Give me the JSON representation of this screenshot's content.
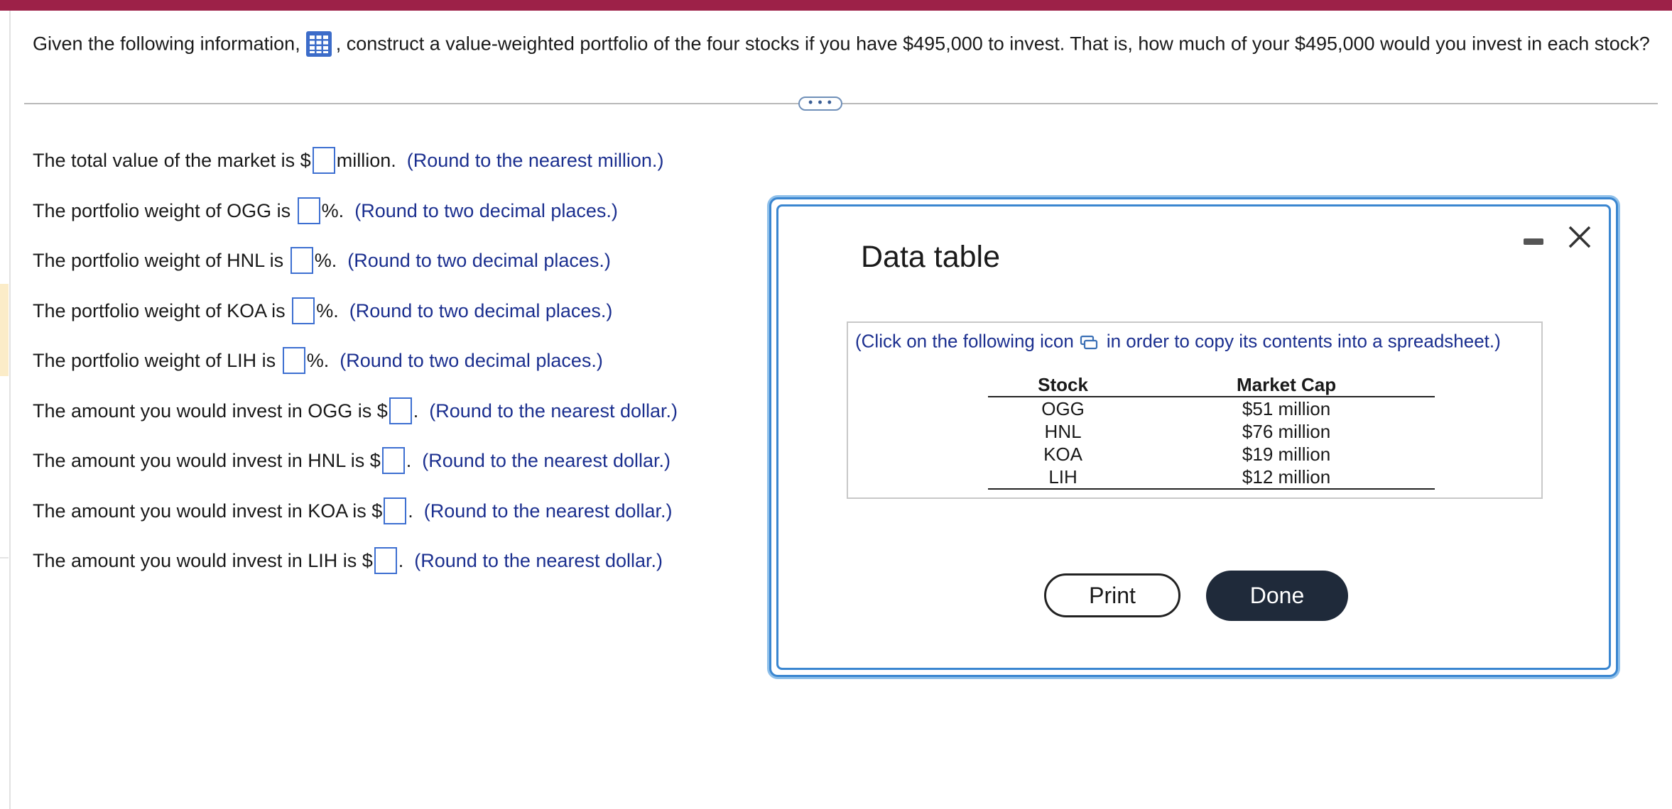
{
  "question": {
    "prefix": "Given the following information,",
    "icon": "data-table-grid-icon",
    "suffix": ", construct a value-weighted portfolio of the four stocks if you have $495,000 to invest. That is, how much of your $495,000 would you invest in each stock?"
  },
  "more_button": "• • •",
  "rows": [
    {
      "label": "The total value of the market is $",
      "after": "million.",
      "hint": "(Round to the nearest million.)"
    },
    {
      "label": "The portfolio weight of OGG is",
      "after": "%.",
      "hint": "(Round to two decimal places.)"
    },
    {
      "label": "The portfolio weight of HNL is",
      "after": "%.",
      "hint": "(Round to two decimal places.)"
    },
    {
      "label": "The portfolio weight of KOA is",
      "after": "%.",
      "hint": "(Round to two decimal places.)"
    },
    {
      "label": "The portfolio weight of LIH is",
      "after": "%.",
      "hint": "(Round to two decimal places.)"
    },
    {
      "label": "The amount you would invest in OGG is $",
      "after": ".",
      "hint": "(Round to the nearest dollar.)"
    },
    {
      "label": "The amount you would invest in HNL is $",
      "after": ".",
      "hint": "(Round to the nearest dollar.)"
    },
    {
      "label": "The amount you would invest in KOA is $",
      "after": ".",
      "hint": "(Round to the nearest dollar.)"
    },
    {
      "label": "The amount you would invest in LIH is $",
      "after": ".",
      "hint": "(Round to the nearest dollar.)"
    }
  ],
  "dialog": {
    "title": "Data table",
    "copy_prefix": "(Click on the following icon",
    "copy_icon": "copy-spreadsheet-icon",
    "copy_suffix": "in order to copy its contents into a spreadsheet.)",
    "table": {
      "headers": [
        "Stock",
        "Market Cap"
      ],
      "rows": [
        [
          "OGG",
          "$51 million"
        ],
        [
          "HNL",
          "$76 million"
        ],
        [
          "KOA",
          "$19 million"
        ],
        [
          "LIH",
          "$12 million"
        ]
      ]
    },
    "print_label": "Print",
    "done_label": "Done",
    "minimize_icon": "minimize-icon",
    "close_icon": "close-icon"
  },
  "colors": {
    "top_bar": "#9d2148",
    "hint_text": "#1b2f8f",
    "input_border": "#3d6fd1",
    "dialog_border": "#3a86d0",
    "done_button": "#1f2a3a"
  }
}
